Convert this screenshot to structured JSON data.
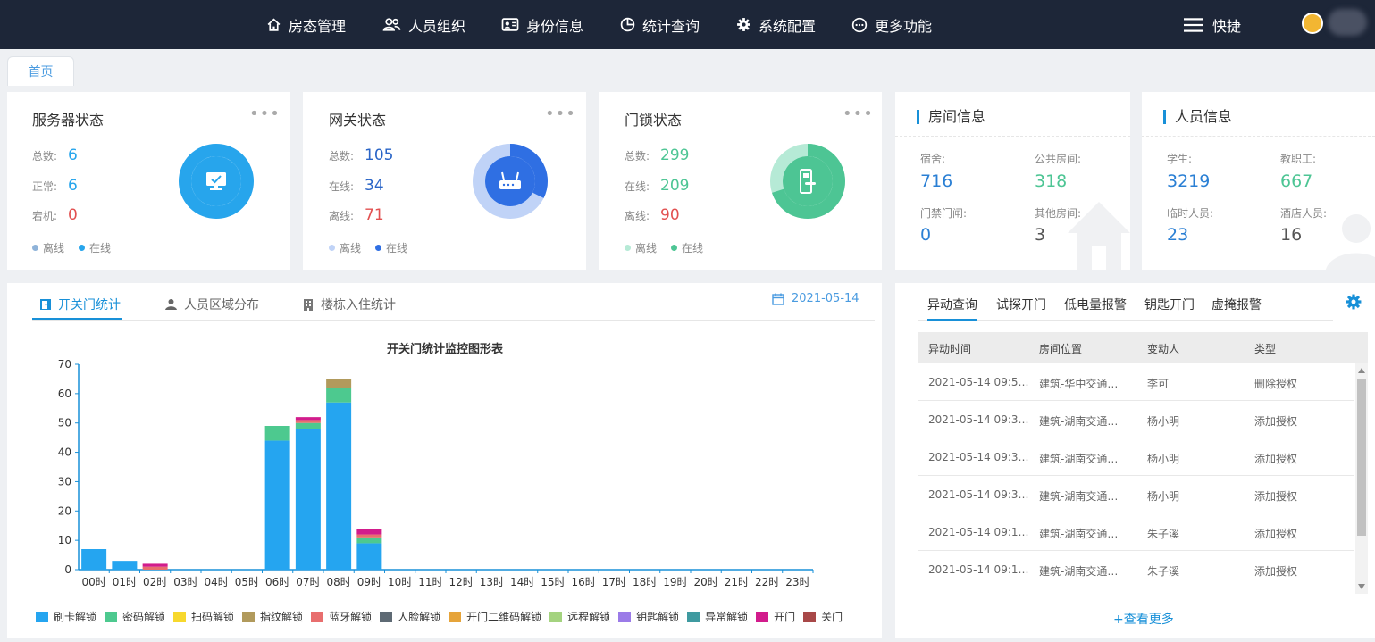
{
  "nav": {
    "items": [
      {
        "label": "房态管理",
        "icon": "home-icon"
      },
      {
        "label": "人员组织",
        "icon": "users-icon"
      },
      {
        "label": "身份信息",
        "icon": "id-card-icon"
      },
      {
        "label": "统计查询",
        "icon": "pie-icon"
      },
      {
        "label": "系统配置",
        "icon": "gear-icon"
      },
      {
        "label": "更多功能",
        "icon": "more-circle-icon"
      }
    ],
    "quick_label": "快捷"
  },
  "tabs": {
    "home": "首页"
  },
  "server": {
    "title": "服务器状态",
    "more": "•••",
    "total_label": "总数:",
    "total": "6",
    "normal_label": "正常:",
    "normal": "6",
    "down_label": "宕机:",
    "down": "0",
    "legend_off": "离线",
    "legend_on": "在线"
  },
  "gateway": {
    "title": "网关状态",
    "more": "•••",
    "total_label": "总数:",
    "total": "105",
    "online_label": "在线:",
    "online": "34",
    "offline_label": "离线:",
    "offline": "71",
    "legend_off": "离线",
    "legend_on": "在线"
  },
  "lock": {
    "title": "门锁状态",
    "more": "•••",
    "total_label": "总数:",
    "total": "299",
    "online_label": "在线:",
    "online": "209",
    "offline_label": "离线:",
    "offline": "90",
    "legend_off": "离线",
    "legend_on": "在线"
  },
  "room_info": {
    "title": "房间信息",
    "dorm_label": "宿舍:",
    "dorm": "716",
    "public_label": "公共房间:",
    "public": "318",
    "gate_label": "门禁门闸:",
    "gate": "0",
    "other_label": "其他房间:",
    "other": "3"
  },
  "people_info": {
    "title": "人员信息",
    "student_label": "学生:",
    "student": "3219",
    "staff_label": "教职工:",
    "staff": "667",
    "temp_label": "临时人员:",
    "temp": "23",
    "hotel_label": "酒店人员:",
    "hotel": "16"
  },
  "colors": {
    "accent": "#1890d8",
    "server_blue": "#27a5ec",
    "gateway_blue": "#2f6fe3",
    "gateway_light": "#c0d3f7",
    "lock_green": "#4dc594",
    "lock_light": "#b6ead6",
    "red": "#e25050",
    "gray_blue": "#2a65c7"
  },
  "chart_tabs": [
    "开关门统计",
    "人员区域分布",
    "楼栋入住统计"
  ],
  "chart_date": "2021-05-14",
  "chart_data": {
    "type": "bar",
    "title": "开关门统计监控图形表",
    "categories": [
      "00时",
      "01时",
      "02时",
      "03时",
      "04时",
      "05时",
      "06时",
      "07时",
      "08时",
      "09时",
      "10时",
      "11时",
      "12时",
      "13时",
      "14时",
      "15时",
      "16时",
      "17时",
      "18时",
      "19时",
      "20时",
      "21时",
      "22时",
      "23时"
    ],
    "ylim": [
      0,
      70
    ],
    "yticks": [
      0,
      10,
      20,
      30,
      40,
      50,
      60,
      70
    ],
    "stacked": true,
    "series": [
      {
        "name": "刷卡解锁",
        "color": "#25a5f0",
        "values": [
          7,
          3,
          0,
          0,
          0,
          0,
          44,
          48,
          57,
          9,
          0,
          0,
          0,
          0,
          0,
          0,
          0,
          0,
          0,
          0,
          0,
          0,
          0,
          0
        ]
      },
      {
        "name": "密码解锁",
        "color": "#4dc98f",
        "values": [
          0,
          0,
          0,
          0,
          0,
          0,
          5,
          2,
          5,
          2,
          0,
          0,
          0,
          0,
          0,
          0,
          0,
          0,
          0,
          0,
          0,
          0,
          0,
          0
        ]
      },
      {
        "name": "扫码解锁",
        "color": "#f7d82d",
        "values": [
          0,
          0,
          0,
          0,
          0,
          0,
          0,
          0,
          0,
          0,
          0,
          0,
          0,
          0,
          0,
          0,
          0,
          0,
          0,
          0,
          0,
          0,
          0,
          0
        ]
      },
      {
        "name": "指纹解锁",
        "color": "#b19a5c",
        "values": [
          0,
          0,
          0,
          0,
          0,
          0,
          0,
          0,
          3,
          0,
          0,
          0,
          0,
          0,
          0,
          0,
          0,
          0,
          0,
          0,
          0,
          0,
          0,
          0
        ]
      },
      {
        "name": "蓝牙解锁",
        "color": "#e86e6e",
        "values": [
          0,
          0,
          1,
          0,
          0,
          0,
          0,
          1,
          0,
          1,
          0,
          0,
          0,
          0,
          0,
          0,
          0,
          0,
          0,
          0,
          0,
          0,
          0,
          0
        ]
      },
      {
        "name": "人脸解锁",
        "color": "#5e6a74",
        "values": [
          0,
          0,
          0,
          0,
          0,
          0,
          0,
          0,
          0,
          0,
          0,
          0,
          0,
          0,
          0,
          0,
          0,
          0,
          0,
          0,
          0,
          0,
          0,
          0
        ]
      },
      {
        "name": "开门二维码解锁",
        "color": "#e6a43a",
        "values": [
          0,
          0,
          0,
          0,
          0,
          0,
          0,
          0,
          0,
          0,
          0,
          0,
          0,
          0,
          0,
          0,
          0,
          0,
          0,
          0,
          0,
          0,
          0,
          0
        ]
      },
      {
        "name": "远程解锁",
        "color": "#a4d37f",
        "values": [
          0,
          0,
          0,
          0,
          0,
          0,
          0,
          0,
          0,
          0,
          0,
          0,
          0,
          0,
          0,
          0,
          0,
          0,
          0,
          0,
          0,
          0,
          0,
          0
        ]
      },
      {
        "name": "钥匙解锁",
        "color": "#9b7be8",
        "values": [
          0,
          0,
          0,
          0,
          0,
          0,
          0,
          0,
          0,
          0,
          0,
          0,
          0,
          0,
          0,
          0,
          0,
          0,
          0,
          0,
          0,
          0,
          0,
          0
        ]
      },
      {
        "name": "异常解锁",
        "color": "#3f9aa0",
        "values": [
          0,
          0,
          0,
          0,
          0,
          0,
          0,
          0,
          0,
          0,
          0,
          0,
          0,
          0,
          0,
          0,
          0,
          0,
          0,
          0,
          0,
          0,
          0,
          0
        ]
      },
      {
        "name": "开门",
        "color": "#d21c8c",
        "values": [
          0,
          0,
          1,
          0,
          0,
          0,
          0,
          1,
          0,
          2,
          0,
          0,
          0,
          0,
          0,
          0,
          0,
          0,
          0,
          0,
          0,
          0,
          0,
          0
        ]
      },
      {
        "name": "关门",
        "color": "#a84848",
        "values": [
          0,
          0,
          0,
          0,
          0,
          0,
          0,
          0,
          0,
          0,
          0,
          0,
          0,
          0,
          0,
          0,
          0,
          0,
          0,
          0,
          0,
          0,
          0,
          0
        ]
      }
    ]
  },
  "right_tabs": [
    "异动查询",
    "试探开门",
    "低电量报警",
    "钥匙开门",
    "虚掩报警"
  ],
  "table": {
    "headers": [
      "异动时间",
      "房间位置",
      "变动人",
      "类型"
    ],
    "rows": [
      [
        "2021-05-14 09:5…",
        "建筑-华中交通…",
        "李可",
        "删除授权"
      ],
      [
        "2021-05-14 09:3…",
        "建筑-湖南交通…",
        "杨小明",
        "添加授权"
      ],
      [
        "2021-05-14 09:3…",
        "建筑-湖南交通…",
        "杨小明",
        "添加授权"
      ],
      [
        "2021-05-14 09:3…",
        "建筑-湖南交通…",
        "杨小明",
        "添加授权"
      ],
      [
        "2021-05-14 09:1…",
        "建筑-湖南交通…",
        "朱子溪",
        "添加授权"
      ],
      [
        "2021-05-14 09:1…",
        "建筑-湖南交通…",
        "朱子溪",
        "添加授权"
      ]
    ]
  },
  "more_label": "+查看更多"
}
